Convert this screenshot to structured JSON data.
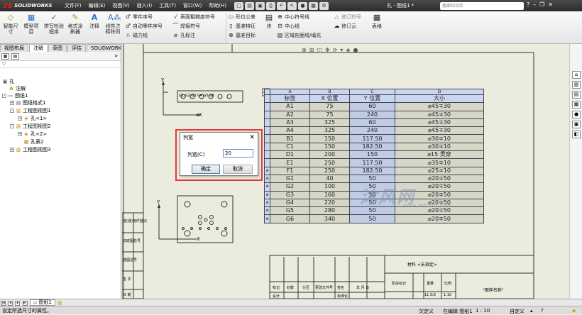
{
  "app": {
    "logo_text": "SOLIDWORKS",
    "menu": [
      "文件(F)",
      "编辑(E)",
      "视图(V)",
      "插入(I)",
      "工具(T)",
      "窗口(W)",
      "帮助(H)"
    ],
    "document_title": "孔 - 图纸1 *",
    "search_placeholder": "搜索知识库"
  },
  "ribbon": {
    "smart_dim": "智能尺寸",
    "model_items": "模型项目",
    "spell_check": "拼写检验程序",
    "format_painter": "格式涂刷器",
    "note": "注释",
    "linear_pattern": "线性注释阵列",
    "balloon": "零件序号",
    "auto_balloon": "自动零件序号",
    "magnetic_line": "磁力线",
    "surface_finish": "表面粗糙度符号",
    "weld_symbol": "焊接符号",
    "hole_callout": "孔标注",
    "gtol": "形位公差",
    "datum_feature": "基准特征",
    "datum_target": "基准目标",
    "blocks": "块",
    "centermark": "中心符号线",
    "centerline": "中心线",
    "area_hatch": "区域剖面线/填充",
    "revision_symbol": "修订符号",
    "revision_cloud": "修订云",
    "tables": "表格"
  },
  "tabs": [
    "视图布局",
    "注解",
    "草图",
    "评估",
    "SOLIDWORKS 插件"
  ],
  "tree": {
    "root": "孔",
    "annotations": "注解",
    "sheet": "图纸1",
    "sheet_format": "图纸格式1",
    "view1": "工程图视图1",
    "hole1": "孔<1>",
    "view2": "工程图视图2",
    "hole2": "孔<2>",
    "hole_table": "孔表2",
    "view3": "工程图视图3"
  },
  "sheet_tab": "图纸1",
  "status": {
    "message": "设定所选尺寸的属性。",
    "underdefined": "欠定义",
    "editing": "在编辑 图纸1",
    "scale": "1 : 10",
    "custom": "自定义"
  },
  "dialog": {
    "title": "列宽",
    "label": "列宽(C)",
    "value": "20",
    "ok": "确定",
    "cancel": "取消"
  },
  "hole_table": {
    "column_letters": [
      "A",
      "B",
      "C",
      "D"
    ],
    "headers": [
      "标签",
      "X 位置",
      "Y 位置",
      "大小"
    ],
    "rows": [
      [
        "A1",
        "75",
        "60",
        "⌀45∓30"
      ],
      [
        "A2",
        "75",
        "240",
        "⌀45∓30"
      ],
      [
        "A3",
        "325",
        "60",
        "⌀45∓30"
      ],
      [
        "A4",
        "325",
        "240",
        "⌀45∓30"
      ],
      [
        "B1",
        "150",
        "117.50",
        "⌀30∓10"
      ],
      [
        "C1",
        "150",
        "182.50",
        "⌀30∓10"
      ],
      [
        "D1",
        "200",
        "150",
        "⌀15 贯穿"
      ],
      [
        "E1",
        "250",
        "117.50",
        "⌀35∓10"
      ],
      [
        "F1",
        "250",
        "182.50",
        "⌀25∓10"
      ],
      [
        "G1",
        "40",
        "50",
        "⌀20∓50"
      ],
      [
        "G2",
        "100",
        "50",
        "⌀20∓50"
      ],
      [
        "G3",
        "160",
        "50",
        "⌀20∓50"
      ],
      [
        "G4",
        "220",
        "50",
        "⌀20∓50"
      ],
      [
        "G5",
        "280",
        "50",
        "⌀20∓50"
      ],
      [
        "G6",
        "340",
        "50",
        "⌀20∓50"
      ]
    ]
  },
  "title_block": {
    "material_mark": "材料 <未指定>",
    "part_name": "\"图样名称\"",
    "left_labels": [
      "借(通)用件登记",
      "旧底图总号",
      "底图总号",
      "签 字",
      "日 期"
    ],
    "bottom_row": [
      "标记",
      "处数",
      "分区",
      "更改文件号",
      "签名",
      "年 月 日"
    ],
    "stage_mark": "阶段标记",
    "weight": "重量",
    "scale_label": "比例",
    "designer": "设计",
    "standardization": "标准化",
    "scale_value": "1:10",
    "page": "11.5/2"
  },
  "view_labels": {
    "axis_y": "Y",
    "axis_x": "X",
    "balloons": "G1 G2 G3 G4 G5 G6"
  },
  "watermark": {
    "text": "沐风网",
    "url": "www.mfcad.com"
  }
}
